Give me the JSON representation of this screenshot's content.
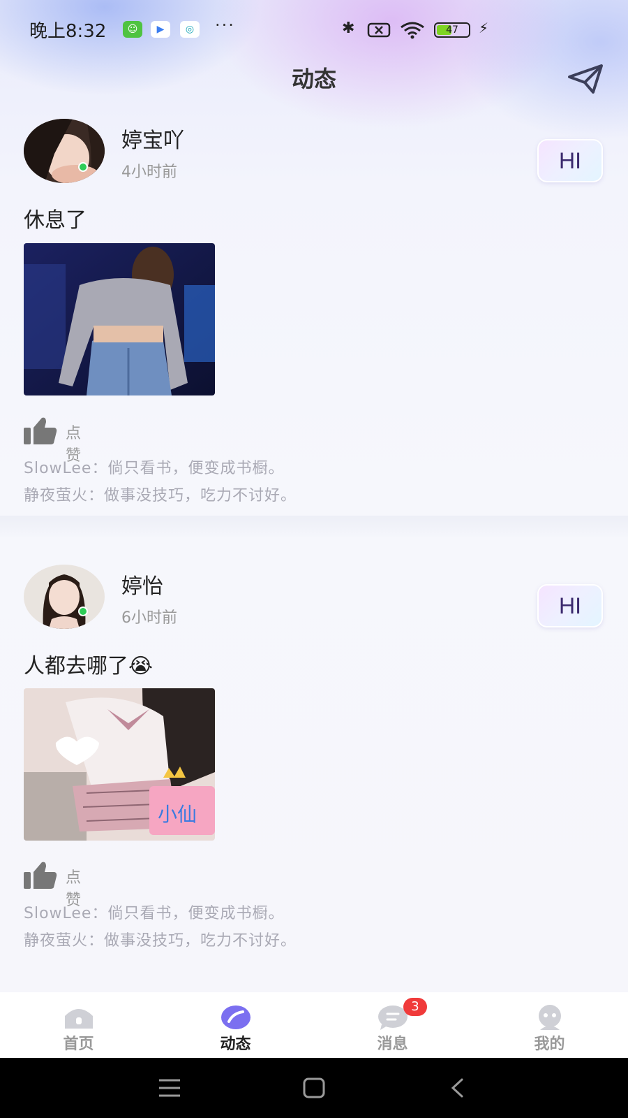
{
  "status_bar": {
    "time": "晚上8:32",
    "dots": "···",
    "battery": "47",
    "battery_level": 0.47,
    "icons": [
      "messenger-app-icon",
      "video-app-icon",
      "mobile-network-app-icon",
      "bluetooth-icon",
      "sim-off-icon",
      "wifi-icon",
      "battery-icon",
      "charging-icon"
    ]
  },
  "header": {
    "title": "动态",
    "send_icon": "paper-plane-icon"
  },
  "posts": [
    {
      "name": "婷宝吖",
      "time": "4小时前",
      "hi": "HI",
      "text": "休息了",
      "like_label": "点赞",
      "comments": [
        {
          "author": "SlowLee",
          "sep": "：",
          "text": "倘只看书，便变成书橱。"
        },
        {
          "author": "静夜萤火",
          "sep": "：",
          "text": "做事没技巧，吃力不讨好。"
        }
      ]
    },
    {
      "name": "婷怡",
      "time": "6小时前",
      "hi": "HI",
      "text": "人都去哪了😭",
      "like_label": "点赞",
      "comments": [
        {
          "author": "SlowLee",
          "sep": "：",
          "text": "倘只看书，便变成书橱。"
        },
        {
          "author": "静夜萤火",
          "sep": "：",
          "text": "做事没技巧，吃力不讨好。"
        }
      ]
    }
  ],
  "bottom_nav": {
    "items": [
      {
        "label": "首页",
        "icon": "home-icon",
        "active": false
      },
      {
        "label": "动态",
        "icon": "moments-icon",
        "active": true
      },
      {
        "label": "消息",
        "icon": "message-icon",
        "active": false,
        "badge": "3"
      },
      {
        "label": "我的",
        "icon": "profile-icon",
        "active": false
      }
    ]
  },
  "colors": {
    "accent": "#7b6ff0",
    "online": "#2ecc57",
    "badge": "#f03a3a"
  }
}
